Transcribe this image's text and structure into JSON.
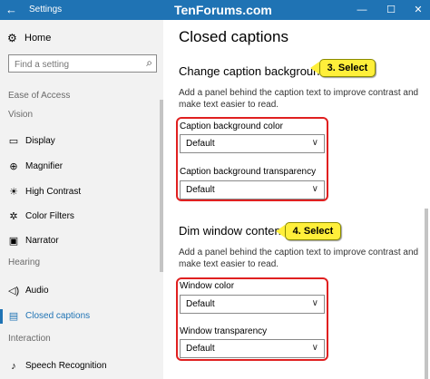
{
  "window": {
    "title": "Settings",
    "watermark": "TenForums.com",
    "back_glyph": "←",
    "minimize_glyph": "—",
    "maximize_glyph": "☐",
    "close_glyph": "✕"
  },
  "sidebar": {
    "home_label": "Home",
    "search_placeholder": "Find a setting",
    "sections": {
      "ease_of_access": "Ease of Access",
      "vision": "Vision",
      "hearing": "Hearing",
      "interaction": "Interaction"
    },
    "items": [
      {
        "label": "Display",
        "icon": "display-icon"
      },
      {
        "label": "Magnifier",
        "icon": "magnifier-icon"
      },
      {
        "label": "High Contrast",
        "icon": "high-contrast-icon"
      },
      {
        "label": "Color Filters",
        "icon": "color-filters-icon"
      },
      {
        "label": "Narrator",
        "icon": "narrator-icon"
      },
      {
        "label": "Audio",
        "icon": "audio-icon"
      },
      {
        "label": "Closed captions",
        "icon": "closed-captions-icon",
        "selected": true
      },
      {
        "label": "Speech Recognition",
        "icon": "speech-recognition-icon"
      }
    ]
  },
  "main": {
    "page_title": "Closed captions",
    "background_section": {
      "heading": "Change caption background",
      "description": "Add a panel behind the caption text to improve contrast and make text easier to read.",
      "color_label": "Caption background color",
      "color_value": "Default",
      "transparency_label": "Caption background transparency",
      "transparency_value": "Default"
    },
    "dim_section": {
      "heading": "Dim window content",
      "description": "Add a panel behind the caption text to improve contrast and make text easier to read.",
      "color_label": "Window color",
      "color_value": "Default",
      "transparency_label": "Window transparency",
      "transparency_value": "Default"
    }
  },
  "callouts": {
    "first": "3. Select",
    "second": "4. Select"
  },
  "colors": {
    "accent": "#1f73b4",
    "highlight_box": "#e02020",
    "callout": "#ffef3a"
  }
}
